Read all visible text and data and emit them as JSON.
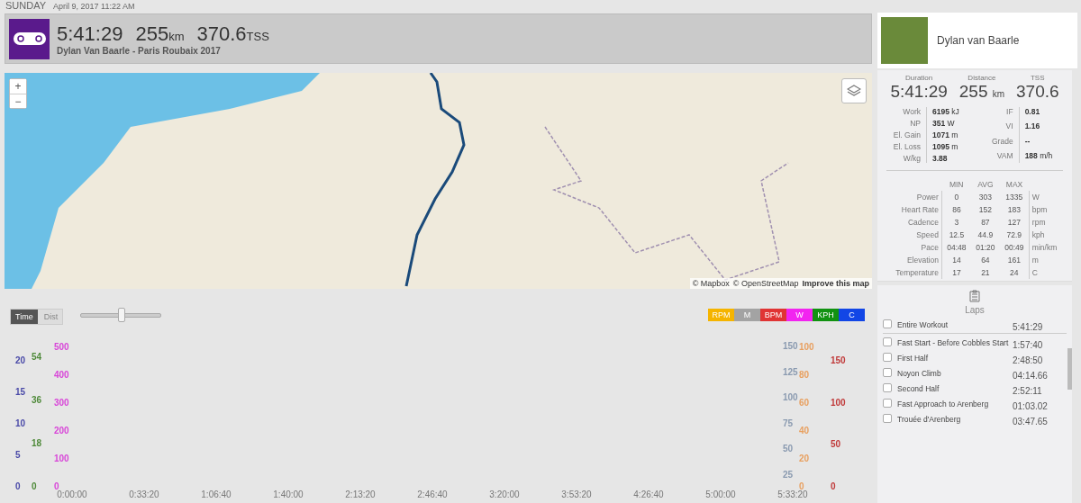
{
  "date_line": {
    "day": "SUNDAY",
    "datetime": "April 9, 2017 11:22 AM"
  },
  "summary": {
    "duration": "5:41:29",
    "distance": "255",
    "distance_unit": "km",
    "tss": "370.6",
    "tss_unit": "TSS",
    "title": "Dylan Van Baarle - Paris Roubaix 2017"
  },
  "athlete": {
    "name": "Dylan van Baarle"
  },
  "map": {
    "zoom_in": "+",
    "zoom_out": "−",
    "attribution": [
      "© Mapbox",
      "© OpenStreetMap",
      "Improve this map"
    ]
  },
  "chart": {
    "toggle": [
      {
        "label": "Time",
        "selected": true
      },
      {
        "label": "Dist",
        "selected": false
      }
    ],
    "zoom_slider": {
      "level": 0.5
    },
    "channels": [
      {
        "label": "RPM",
        "color": "#f5b400"
      },
      {
        "label": "M",
        "color": "#a3a3a3"
      },
      {
        "label": "BPM",
        "color": "#e03434"
      },
      {
        "label": "W",
        "color": "#f224f0"
      },
      {
        "label": "KPH",
        "color": "#119211"
      },
      {
        "label": "C",
        "color": "#1246e6"
      }
    ],
    "left_axes": [
      {
        "color": "#4a4aa8",
        "ticks": [
          "20",
          "15",
          "10",
          "5",
          "0"
        ]
      },
      {
        "color": "#4f8a3a",
        "ticks": [
          "54",
          "36",
          "18",
          "0"
        ]
      },
      {
        "color": "#d846d8",
        "ticks": [
          "500",
          "400",
          "300",
          "200",
          "100",
          "0"
        ]
      }
    ],
    "right_axes": [
      {
        "color": "#8a9ab0",
        "ticks": [
          "150",
          "125",
          "100",
          "75",
          "50",
          "25"
        ]
      },
      {
        "color": "#e8a060",
        "ticks": [
          "100",
          "80",
          "60",
          "40",
          "20",
          "0"
        ]
      },
      {
        "color": "#c03a3a",
        "ticks": [
          "150",
          "100",
          "50",
          "0"
        ]
      }
    ],
    "x_ticks": [
      "0:00:00",
      "0:33:20",
      "1:06:40",
      "1:40:00",
      "2:13:20",
      "2:46:40",
      "3:20:00",
      "3:53:20",
      "4:26:40",
      "5:00:00",
      "5:33:20"
    ]
  },
  "stats": {
    "totals": [
      {
        "label": "Duration",
        "value": "5:41:29"
      },
      {
        "label": "Distance",
        "value": "255",
        "unit": "km"
      },
      {
        "label": "TSS",
        "value": "370.6"
      }
    ],
    "metrics_left": [
      {
        "label": "Work",
        "value": "6195",
        "unit": "kJ"
      },
      {
        "label": "NP",
        "value": "351",
        "unit": "W"
      },
      {
        "label": "El. Gain",
        "value": "1071",
        "unit": "m"
      },
      {
        "label": "El. Loss",
        "value": "1095",
        "unit": "m"
      },
      {
        "label": "W/kg",
        "value": "3.88"
      }
    ],
    "metrics_right": [
      {
        "label": "IF",
        "value": "0.81"
      },
      {
        "label": "VI",
        "value": "1.16"
      },
      {
        "label": "Grade",
        "value": "--"
      },
      {
        "label": "VAM",
        "value": "188",
        "unit": "m/h"
      }
    ],
    "columns": [
      "MIN",
      "AVG",
      "MAX"
    ],
    "rows": [
      {
        "label": "Power",
        "min": "0",
        "avg": "303",
        "max": "1335",
        "unit": "W"
      },
      {
        "label": "Heart Rate",
        "min": "86",
        "avg": "152",
        "max": "183",
        "unit": "bpm"
      },
      {
        "label": "Cadence",
        "min": "3",
        "avg": "87",
        "max": "127",
        "unit": "rpm"
      },
      {
        "label": "Speed",
        "min": "12.5",
        "avg": "44.9",
        "max": "72.9",
        "unit": "kph"
      },
      {
        "label": "Pace",
        "min": "04:48",
        "avg": "01:20",
        "max": "00:49",
        "unit": "min/km"
      },
      {
        "label": "Elevation",
        "min": "14",
        "avg": "64",
        "max": "161",
        "unit": "m"
      },
      {
        "label": "Temperature",
        "min": "17",
        "avg": "21",
        "max": "24",
        "unit": "C"
      }
    ]
  },
  "laps": {
    "title": "Laps",
    "items": [
      {
        "name": "Entire Workout",
        "time": "5:41:29",
        "checked": false
      },
      {
        "name": "Fast Start - Before Cobbles Start",
        "time": "1:57:40",
        "checked": false
      },
      {
        "name": "First Half",
        "time": "2:48:50",
        "checked": false
      },
      {
        "name": "Noyon Climb",
        "time": "04:14.66",
        "checked": false
      },
      {
        "name": "Second Half",
        "time": "2:52:11",
        "checked": false
      },
      {
        "name": "Fast Approach to Arenberg",
        "time": "01:03.02",
        "checked": false
      },
      {
        "name": "Trouée d'Arenberg",
        "time": "03:47.65",
        "checked": false
      }
    ]
  }
}
